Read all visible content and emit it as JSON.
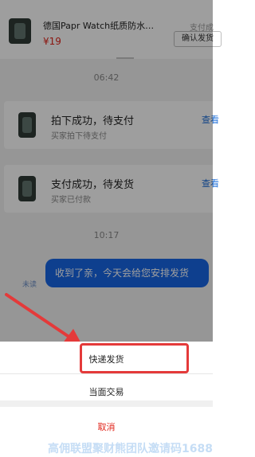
{
  "product": {
    "title": "德国Papr Watch纸质防水黑...",
    "price": "¥19",
    "status": "支付成",
    "confirm_button": "确认发货"
  },
  "chat": {
    "time_first": "06:42",
    "orders": [
      {
        "title": "拍下成功，待支付",
        "sub": "买家拍下待支付",
        "link": "查看"
      },
      {
        "title": "支付成功，待发货",
        "sub": "买家已付款",
        "link": "查看"
      }
    ],
    "time_second": "10:17",
    "message": "收到了亲，今天会给您安排发货",
    "read_status": "未读"
  },
  "sheet": {
    "express_label": "快递发货",
    "face_to_face_label": "当面交易",
    "cancel_label": "取消"
  },
  "watermark": "高佣联盟聚财熊团队邀请码1688",
  "colors": {
    "price_red": "#e1251b",
    "bubble_blue": "#1766e6",
    "link_blue": "#1e6fd9",
    "annotation_red": "#e43a3a"
  }
}
